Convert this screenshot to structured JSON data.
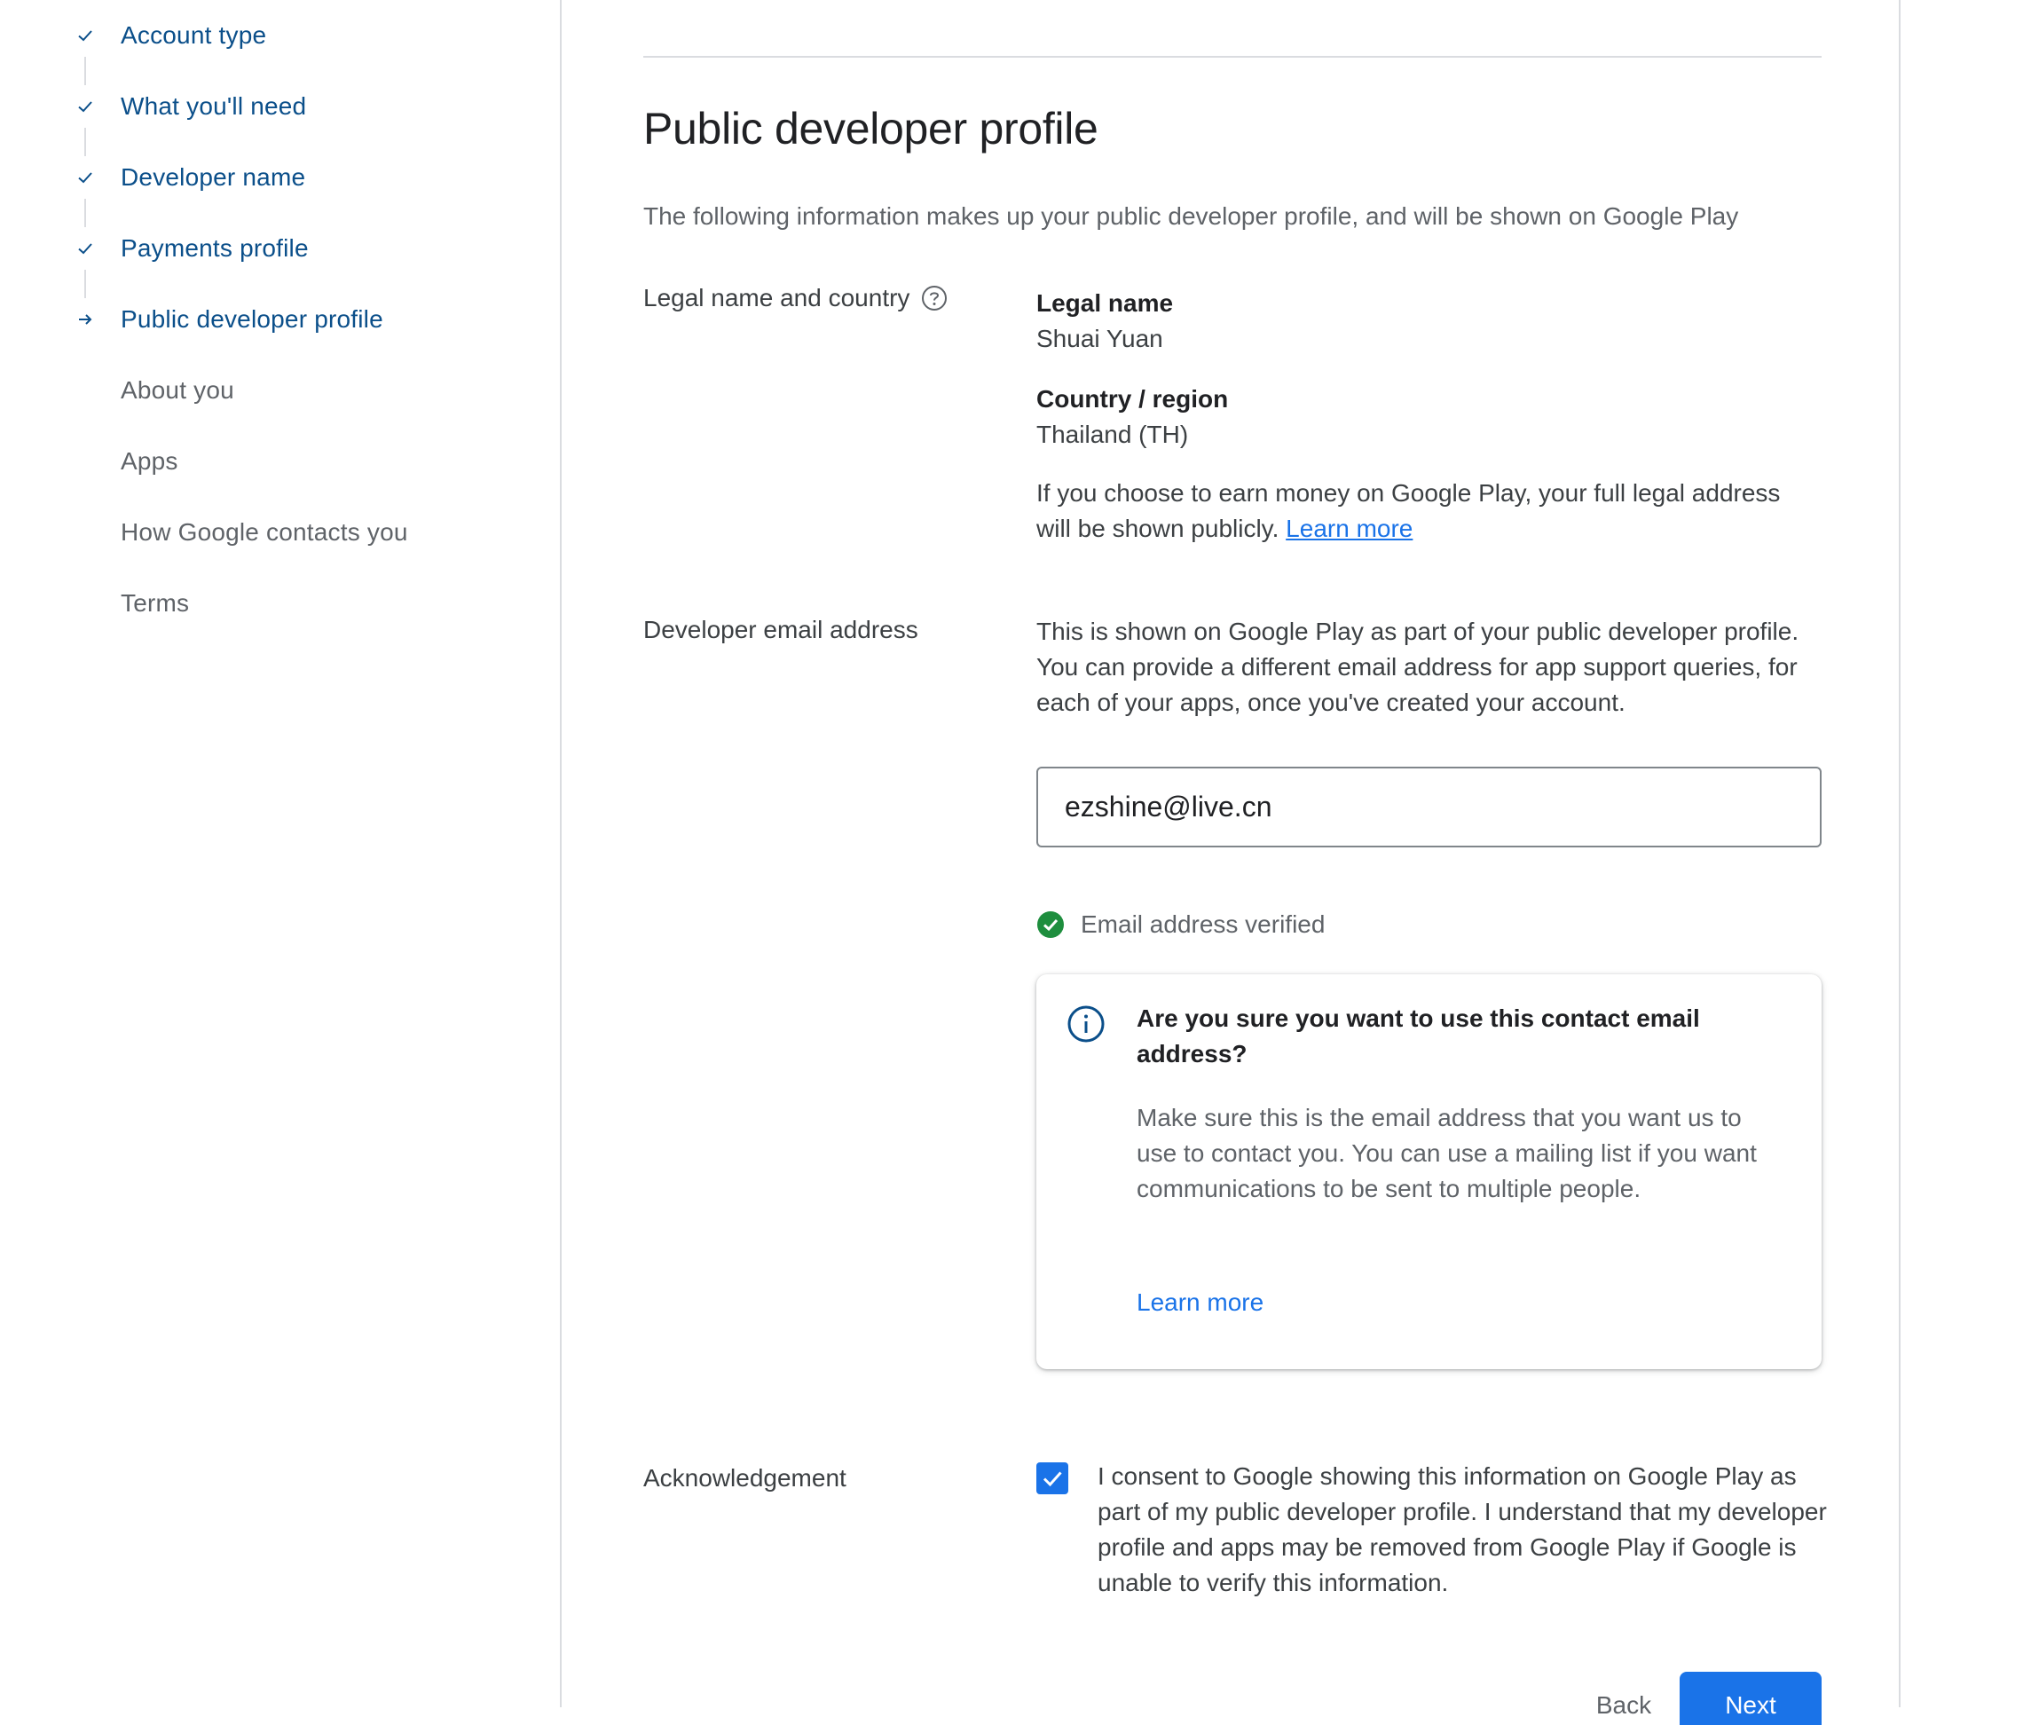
{
  "sidebar": {
    "steps": [
      {
        "label": "Account type",
        "state": "done"
      },
      {
        "label": "What you'll need",
        "state": "done"
      },
      {
        "label": "Developer name",
        "state": "done"
      },
      {
        "label": "Payments profile",
        "state": "done"
      },
      {
        "label": "Public developer profile",
        "state": "current"
      },
      {
        "label": "About you",
        "state": "todo"
      },
      {
        "label": "Apps",
        "state": "todo"
      },
      {
        "label": "How Google contacts you",
        "state": "todo"
      },
      {
        "label": "Terms",
        "state": "todo"
      }
    ]
  },
  "main": {
    "title": "Public developer profile",
    "intro": "The following information makes up your public developer profile, and will be shown on Google Play",
    "legal": {
      "row_label": "Legal name and country",
      "help_icon": "help-circle-icon",
      "name_title": "Legal name",
      "name_value": "Shuai Yuan",
      "country_title": "Country / region",
      "country_value": "Thailand (TH)",
      "note": "If you choose to earn money on Google Play, your full legal address will be shown publicly.",
      "note_link": "Learn more"
    },
    "email": {
      "row_label": "Developer email address",
      "description": "This is shown on Google Play as part of your public developer profile. You can provide a different email address for app support queries, for each of your apps, once you've created your account.",
      "value": "ezshine@live.cn",
      "verified_text": "Email address verified",
      "card": {
        "title": "Are you sure you want to use this contact email address?",
        "body": "Make sure this is the email address that you want us to use to contact you. You can use a mailing list if you want communications to be sent to multiple people.",
        "link": "Learn more"
      }
    },
    "acknowledgement": {
      "row_label": "Acknowledgement",
      "checked": true,
      "text": "I consent to Google showing this information on Google Play as part of my public developer profile. I understand that my developer profile and apps may be removed from Google Play if Google is unable to verify this information."
    },
    "buttons": {
      "back": "Back",
      "next": "Next"
    }
  },
  "colors": {
    "accent": "#1a73e8",
    "nav_active": "#0b4f8a",
    "verified_green": "#1e8e3e",
    "muted_text": "#5f6368"
  }
}
